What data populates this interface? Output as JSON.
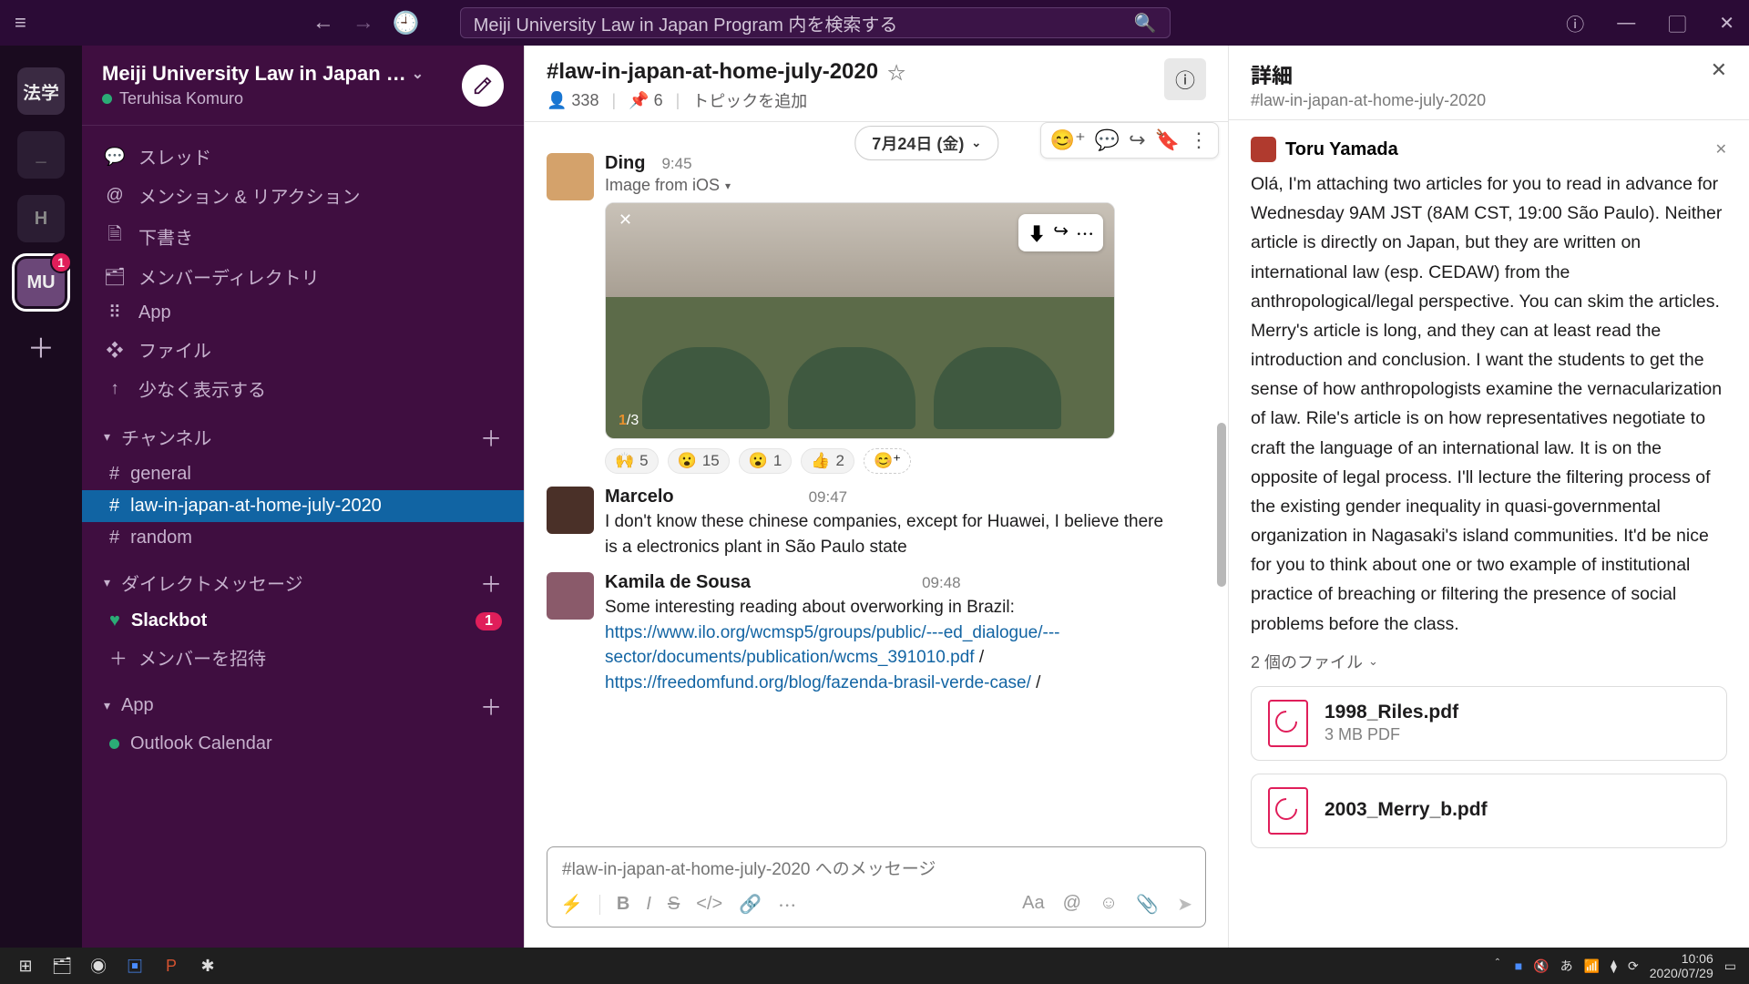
{
  "titlebar": {
    "search_placeholder": "Meiji University Law in Japan Program 内を検索する"
  },
  "rail": {
    "workspaces": [
      {
        "label": "法学"
      },
      {
        "label": "_"
      },
      {
        "label": "H"
      },
      {
        "label": "MU",
        "selected": true,
        "badge": "1"
      }
    ]
  },
  "sidebar": {
    "workspace_name": "Meiji University Law in Japan …",
    "user_name": "Teruhisa Komuro",
    "nav": [
      {
        "icon": "💬",
        "label": "スレッド"
      },
      {
        "icon": "@",
        "label": "メンション & リアクション"
      },
      {
        "icon": "📄",
        "label": "下書き"
      },
      {
        "icon": "📇",
        "label": "メンバーディレクトリ"
      },
      {
        "icon": "⋮⋮⋮",
        "label": "App"
      },
      {
        "icon": "❖",
        "label": "ファイル"
      },
      {
        "icon": "↑",
        "label": "少なく表示する"
      }
    ],
    "channels_header": "チャンネル",
    "channels": [
      {
        "name": "general"
      },
      {
        "name": "law-in-japan-at-home-july-2020",
        "selected": true
      },
      {
        "name": "random"
      }
    ],
    "dm_header": "ダイレクトメッセージ",
    "dm": {
      "name": "Slackbot",
      "badge": "1"
    },
    "invite": "メンバーを招待",
    "app_header": "App",
    "app_item": "Outlook Calendar"
  },
  "channel": {
    "name": "#law-in-japan-at-home-july-2020",
    "member_count": "338",
    "pin_count": "6",
    "topic_add": "トピックを追加",
    "date_label": "7月24日 (金)",
    "messages": [
      {
        "author": "Ding",
        "time": "9:45",
        "subline": "Image from iOS",
        "image_counter_current": "1",
        "image_counter_total": "/3",
        "reactions": [
          {
            "emoji": "🙌",
            "count": "5"
          },
          {
            "emoji": "😮",
            "count": "15"
          },
          {
            "emoji": "😮",
            "count": "1"
          },
          {
            "emoji": "👍",
            "count": "2"
          }
        ]
      },
      {
        "author": "Marcelo",
        "time": "09:47",
        "text": "I don't know these chinese companies, except for Huawei, I believe there is a electronics plant in São Paulo state"
      },
      {
        "author": "Kamila de Sousa",
        "time": "09:48",
        "text_pre": "Some interesting reading about overworking in Brazil: ",
        "link1": "https://www.ilo.org/wcmsp5/groups/public/---ed_dialogue/---sector/documents/publication/wcms_391010.pdf",
        "sep1": " / ",
        "link2": "https://freedomfund.org/blog/fazenda-brasil-verde-case/",
        "sep2": " / "
      }
    ],
    "composer_placeholder": "#law-in-japan-at-home-july-2020 へのメッセージ"
  },
  "details": {
    "title": "詳細",
    "subtitle": "#law-in-japan-at-home-july-2020",
    "message": {
      "author": "Toru Yamada",
      "text": "Olá, I'm attaching two articles for you to read in advance for Wednesday 9AM JST (8AM CST, 19:00 São Paulo). Neither article is directly on Japan, but they are written on international law (esp. CEDAW) from the anthropological/legal perspective. You can skim the articles. Merry's article is long, and they can at least read the introduction and conclusion.  I want the students to get the sense of how anthropologists examine the vernacularization of law. Rile's article is on how representatives negotiate to craft the language of an international law. It is on the opposite of legal process. I'll lecture the filtering process of the existing gender inequality in quasi-governmental  organization in Nagasaki's island communities. It'd be nice for you to think about one or two example of institutional practice of breaching or filtering the presence of social problems before the class."
    },
    "files_label": "2 個のファイル",
    "files": [
      {
        "name": "1998_Riles.pdf",
        "size": "3 MB PDF"
      },
      {
        "name": "2003_Merry_b.pdf",
        "size": ""
      }
    ]
  },
  "taskbar": {
    "time": "10:06",
    "date": "2020/07/29"
  }
}
